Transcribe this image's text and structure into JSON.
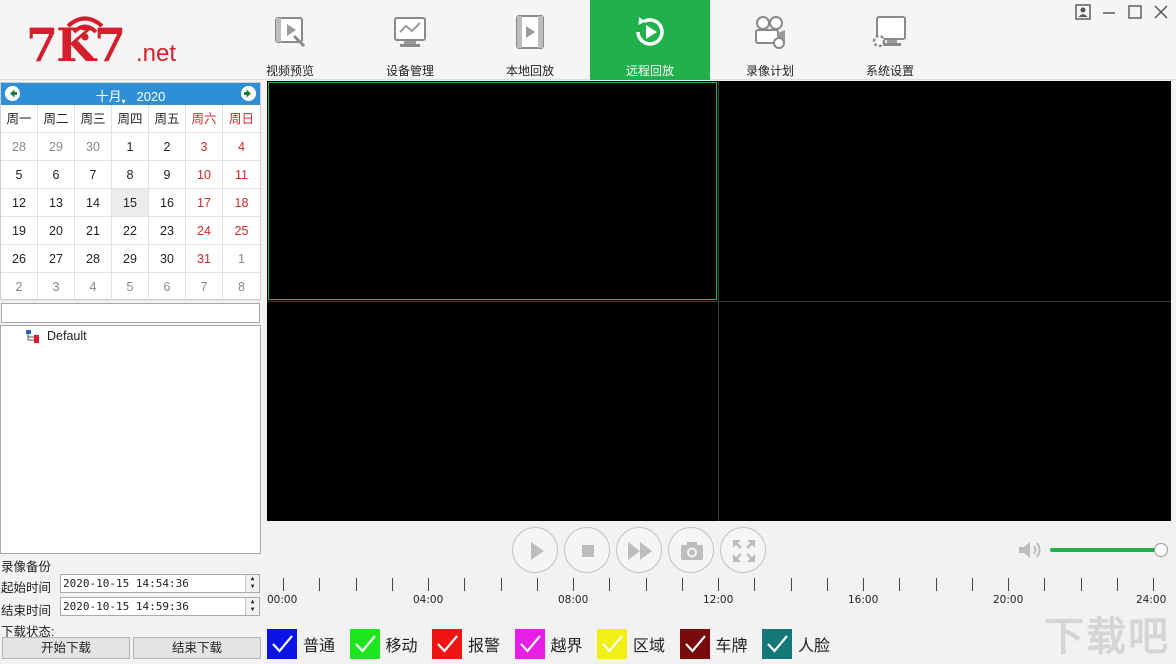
{
  "logo": {
    "brand": "7K7",
    "suffix": ".net"
  },
  "nav": [
    {
      "id": "preview",
      "label": "视频预览",
      "icon": "video-preview-icon"
    },
    {
      "id": "device",
      "label": "设备管理",
      "icon": "device-manage-icon"
    },
    {
      "id": "local",
      "label": "本地回放",
      "icon": "film-icon"
    },
    {
      "id": "remote",
      "label": "远程回放",
      "icon": "replay-icon",
      "active": true
    },
    {
      "id": "schedule",
      "label": "录像计划",
      "icon": "camera-schedule-icon"
    },
    {
      "id": "settings",
      "label": "系统设置",
      "icon": "monitor-gear-icon"
    }
  ],
  "accent": "#21b14b",
  "calendar": {
    "month": "十月",
    "year": "2020",
    "weekdays": [
      "周一",
      "周二",
      "周三",
      "周四",
      "周五",
      "周六",
      "周日"
    ],
    "selected": "15",
    "rows": [
      [
        "28",
        "29",
        "30",
        "1",
        "2",
        "3",
        "4"
      ],
      [
        "5",
        "6",
        "7",
        "8",
        "9",
        "10",
        "11"
      ],
      [
        "12",
        "13",
        "14",
        "15",
        "16",
        "17",
        "18"
      ],
      [
        "19",
        "20",
        "21",
        "22",
        "23",
        "24",
        "25"
      ],
      [
        "26",
        "27",
        "28",
        "29",
        "30",
        "31",
        "1"
      ],
      [
        "2",
        "3",
        "4",
        "5",
        "6",
        "7",
        "8"
      ]
    ]
  },
  "tree": {
    "filter": "",
    "root": "Default"
  },
  "backup": {
    "title": "录像备份",
    "start_label": "起始时间",
    "start_value": "2020-10-15 14:54:36",
    "end_label": "结束时间",
    "end_value": "2020-10-15 14:59:36",
    "status_label": "下载状态:",
    "start_download": "开始下载",
    "stop_download": "结束下载"
  },
  "volume": {
    "level": 0.97
  },
  "timeline": {
    "labels": [
      "00:00",
      "04:00",
      "08:00",
      "12:00",
      "16:00",
      "20:00",
      "24:00"
    ]
  },
  "legend": [
    {
      "label": "普通",
      "color": "#0a14e6"
    },
    {
      "label": "移动",
      "color": "#1ee61e"
    },
    {
      "label": "报警",
      "color": "#f01414"
    },
    {
      "label": "越界",
      "color": "#e61ee6"
    },
    {
      "label": "区域",
      "color": "#f0f014"
    },
    {
      "label": "车牌",
      "color": "#780a0a"
    },
    {
      "label": "人脸",
      "color": "#147878"
    }
  ],
  "watermark": {
    "text": "下载吧"
  }
}
